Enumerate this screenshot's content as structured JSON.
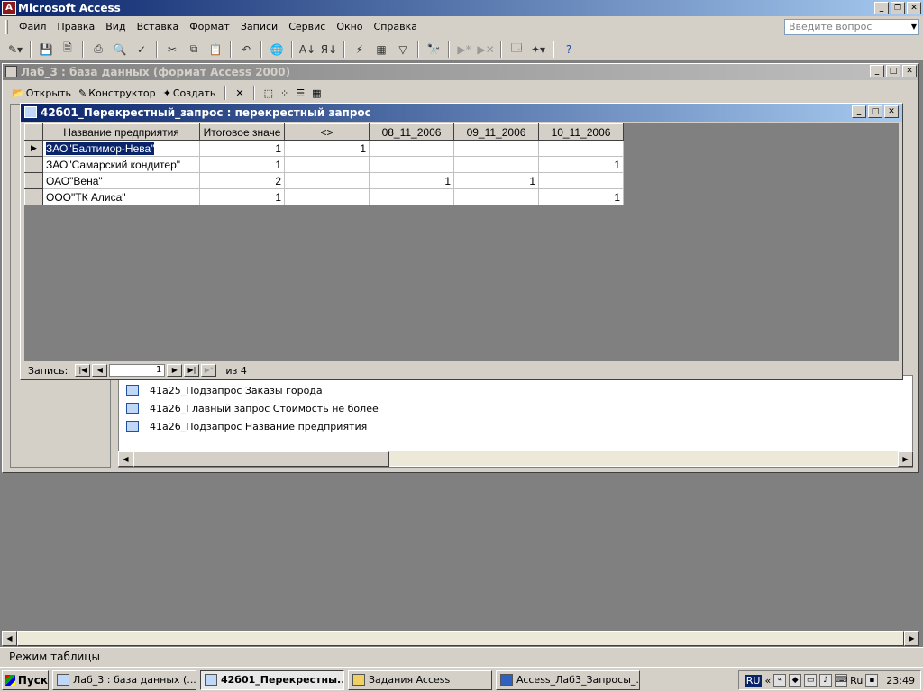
{
  "app": {
    "title": "Microsoft Access"
  },
  "menu": [
    "Файл",
    "Правка",
    "Вид",
    "Вставка",
    "Формат",
    "Записи",
    "Сервис",
    "Окно",
    "Справка"
  ],
  "ask": {
    "placeholder": "Введите вопрос"
  },
  "toolbar_icons": [
    "view-icon",
    "save-icon",
    "search-file-icon",
    "print-icon",
    "print-preview-icon",
    "spelling-icon",
    "cut-icon",
    "copy-icon",
    "paste-icon",
    "undo-icon",
    "hyperlink-icon",
    "sort-ascending-icon",
    "sort-descending-icon",
    "filter-by-selection-icon",
    "filter-by-form-icon",
    "apply-filter-icon",
    "find-icon",
    "new-record-icon",
    "delete-record-icon",
    "database-window-icon",
    "new-object-icon",
    "help-icon"
  ],
  "db_window": {
    "title": "Лаб_3 : база данных (формат Access 2000)",
    "tool_open": "Открыть",
    "tool_design": "Конструктор",
    "tool_create": "Создать",
    "items": [
      "41а25_Подзапрос Заказы города",
      "41а26_Главный запрос Стоимость не более",
      "41а26_Подзапрос Название предприятия"
    ]
  },
  "query_window": {
    "title": "42б01_Перекрестный_запрос : перекрестный запрос",
    "columns": [
      "Название предприятия",
      "Итоговое значе",
      "<>",
      "08_11_2006",
      "09_11_2006",
      "10_11_2006"
    ],
    "rows": [
      [
        "ЗАО\"Балтимор-Нева\"",
        "1",
        "1",
        "",
        "",
        ""
      ],
      [
        "ЗАО\"Самарский кондитер\"",
        "1",
        "",
        "",
        "",
        "1"
      ],
      [
        "ОАО\"Вена\"",
        "2",
        "",
        "1",
        "1",
        ""
      ],
      [
        "ООО\"ТК Алиса\"",
        "1",
        "",
        "",
        "",
        "1"
      ]
    ],
    "nav_label": "Запись:",
    "current_record": "1",
    "of_label": "из  4"
  },
  "status": {
    "text": "Режим таблицы"
  },
  "taskbar": {
    "start": "Пуск",
    "tasks": [
      "Лаб_3 : база данных (...",
      "42б01_Перекрестны...",
      "Задания Access",
      "Access_Лаб3_Запросы_..."
    ],
    "lang": "RU",
    "lang2": "Ru",
    "clock": "23:49"
  }
}
